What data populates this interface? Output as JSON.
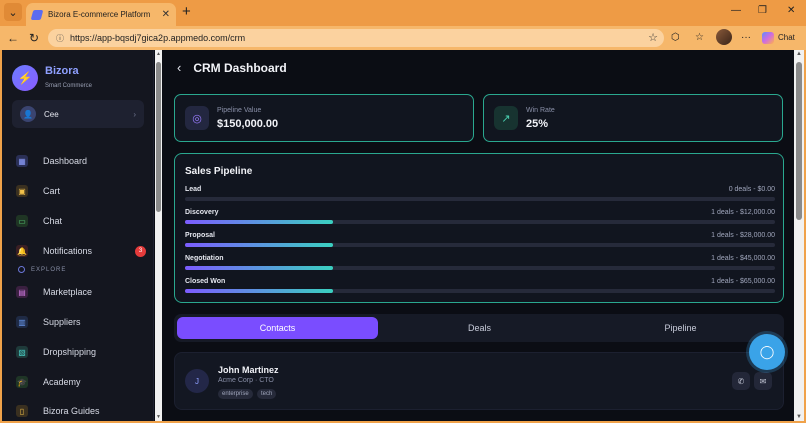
{
  "browser": {
    "tab_title": "Bizora E-commerce Platform",
    "url": "https://app-bqsdj7gica2p.appmedo.com/crm",
    "chat_label": "Chat"
  },
  "sidebar": {
    "brand": "Bizora",
    "tagline": "Smart Commerce",
    "user": {
      "initial": "",
      "name": "Cee"
    },
    "items": [
      {
        "label": "Dashboard"
      },
      {
        "label": "Cart"
      },
      {
        "label": "Chat"
      },
      {
        "label": "Notifications",
        "badge": "3"
      }
    ],
    "explore_label": "EXPLORE",
    "explore_items": [
      {
        "label": "Marketplace"
      },
      {
        "label": "Suppliers"
      },
      {
        "label": "Dropshipping"
      },
      {
        "label": "Academy"
      },
      {
        "label": "Bizora Guides"
      }
    ]
  },
  "main": {
    "title": "CRM Dashboard",
    "stats": [
      {
        "label": "Pipeline Value",
        "value": "$150,000.00"
      },
      {
        "label": "Win Rate",
        "value": "25%"
      }
    ],
    "pipeline": {
      "title": "Sales Pipeline",
      "stages": [
        {
          "name": "Lead",
          "info": "0 deals - $0.00",
          "fill": 0
        },
        {
          "name": "Discovery",
          "info": "1 deals - $12,000.00",
          "fill": 0.25
        },
        {
          "name": "Proposal",
          "info": "1 deals - $28,000.00",
          "fill": 0.25
        },
        {
          "name": "Negotiation",
          "info": "1 deals - $45,000.00",
          "fill": 0.25
        },
        {
          "name": "Closed Won",
          "info": "1 deals - $65,000.00",
          "fill": 0.25
        }
      ]
    },
    "tabs": [
      {
        "label": "Contacts",
        "active": true
      },
      {
        "label": "Deals",
        "active": false
      },
      {
        "label": "Pipeline",
        "active": false
      }
    ],
    "contact": {
      "initial": "J",
      "name": "John Martinez",
      "company": "Acme Corp · CTO",
      "tags": [
        "enterprise",
        "tech"
      ]
    }
  },
  "colors": {
    "accent": "#7a4dff",
    "border": "#2aa88f",
    "badge": "#e53b3b",
    "fab": "#3aa3e8"
  }
}
